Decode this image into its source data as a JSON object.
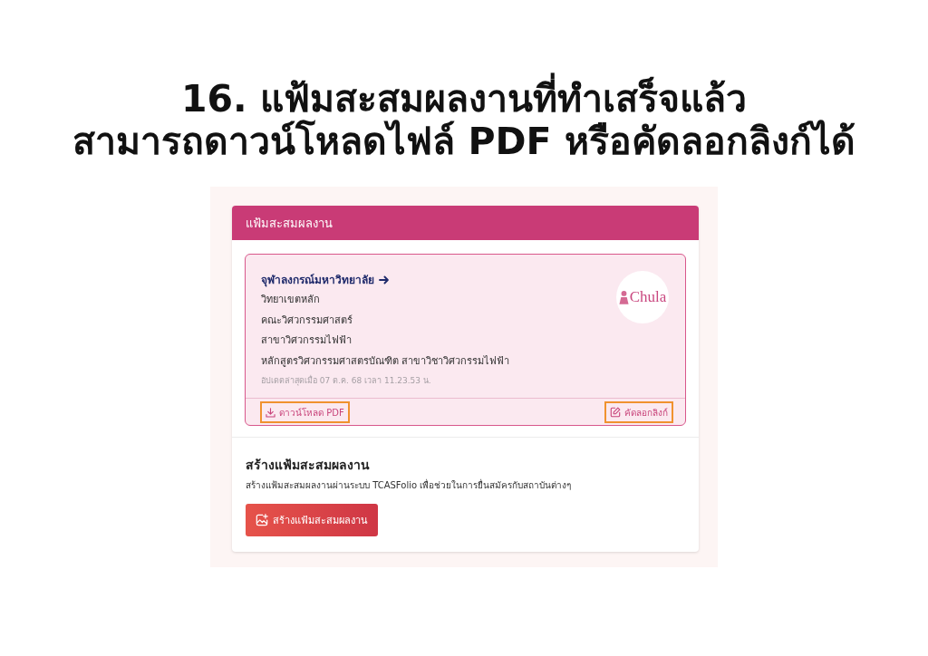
{
  "page_title": {
    "lines": [
      "16. แฟ้มสะสมผลงานที่ทำเสร็จแล้ว",
      "สามารถดาวน์โหลดไฟล์ PDF หรือคัดลอกลิงก์ได้"
    ]
  },
  "portfolio_panel": {
    "title": "แฟ้มสะสมผลงาน",
    "portfolio_card": {
      "university": "จุฬาลงกรณ์มหาวิทยาลัย",
      "details": [
        "วิทยาเขตหลัก",
        "คณะวิศวกรรมศาสตร์",
        "สาขาวิศวกรรมไฟฟ้า",
        "หลักสูตรวิศวกรรมศาสตรบัณฑิต สาขาวิชาวิศวกรรมไฟฟ้า"
      ],
      "updated": "อัปเดตล่าสุดเมื่อ 07 ต.ค. 68 เวลา 11.23.53 น.",
      "logo_text": "Chula",
      "actions": [
        {
          "kind": "download",
          "label": "ดาวน์โหลด PDF",
          "highlighted": true
        },
        {
          "kind": "copy_link",
          "label": "คัดลอกลิงก์",
          "highlighted": true
        }
      ]
    }
  },
  "create_section": {
    "heading": "สร้างแฟ้มสะสมผลงาน",
    "description": "สร้างแฟ้มสะสมผลงานผ่านระบบ TCASFolio เพื่อช่วยในการยื่นสมัครกับสถาบันต่างๆ",
    "button": "สร้างแฟ้มสะสมผลงาน"
  }
}
